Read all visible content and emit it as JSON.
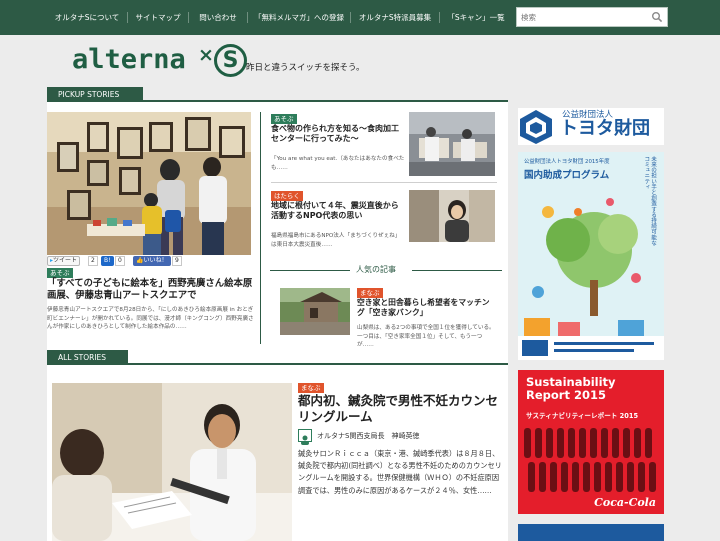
{
  "nav": {
    "items": [
      "オルタナSについて",
      "サイトマップ",
      "問い合わせ",
      "「無料メルマガ」への登録",
      "オルタナS特派員募集",
      "「Sキャン」一覧"
    ],
    "search_placeholder": "検索"
  },
  "logo": {
    "text": "alterna",
    "x": "×",
    "s": "S",
    "tagline": "昨日と違うスイッチを探そう。"
  },
  "sections": {
    "pickup": "PICKUP STORIES",
    "all": "ALL STORIES",
    "popular": "人気の記事"
  },
  "feature": {
    "social": {
      "tweet": "ツイート",
      "tweet_count": "2",
      "bookmark": "B!",
      "bookmark_count": "0",
      "like": "いいね！",
      "like_count": "9"
    },
    "category": "あそぶ",
    "title": "「すべての子どもに絵本を」西野亮廣さん絵本原画展、伊藤忠青山アートスクエアで",
    "excerpt": "伊藤忠青山アートスクエアで8月28日から、「にしのあきひろ絵本原画展 in おとぎ町ビエンナーレ」が開かれている。同展では、漫才師（キングコング）西野亮廣さんが作家にしのあきひろとして制作した絵本作品の……"
  },
  "pickups": [
    {
      "category": "あそぶ",
      "title": "食べ物の作られ方を知る～食肉加工センターに行ってみた～",
      "excerpt": "「You are what you eat.（あなたはあなたの食べたも……"
    },
    {
      "category": "はたらく",
      "title": "地域に根付いて４年、震災直後から活動するNPO代表の思い",
      "excerpt": "福島県福島市にあるNPO法人「まちづくりぜぇね」は東日本大震災直後……"
    }
  ],
  "popular": [
    {
      "category": "まなぶ",
      "title": "空き家と田舎暮らし希望者をマッチング「空き家バンク」",
      "excerpt": "山梨県は、ある2つの事項で全国１位を獲得している。一つ目は、「空き家率全国１位」そして、もう一つが……"
    }
  ],
  "all_story": {
    "category": "まなぶ",
    "title": "都内初、鍼灸院で男性不妊カウンセリングルーム",
    "author": "オルタナS関西支局長　神崎英徳",
    "excerpt": "鍼灸サロンＲｉｃｃａ（東京・港、鍼崎季代表）は８月８日、鍼灸院で都内初(同社調べ）となる男性不妊のためのカウンセリングルームを開設する。世界保健機構（ＷＨＯ）の不妊症原因調査では、男性のみに原因があるケースが２４％、女性……"
  },
  "sidebar": {
    "foundation": {
      "small": "公益財団法人",
      "name": "トヨタ財団"
    },
    "grant": {
      "header": "公益財団法人トヨタ財団 2015年度",
      "title": "国内助成プログラム",
      "side": "未来の担い手と創造する持続可能なコミュニティ"
    },
    "report": {
      "title": "Sustainability Report 2015",
      "subtitle": "サスティナビリティーレポート 2015",
      "brand": "Coca-Cola"
    }
  },
  "colors": {
    "brand": "#2d5a45",
    "category_orange": "#e0542c",
    "category_green": "#2e7d5b",
    "coke_red": "#e41e2b",
    "toyota_blue": "#1d5a9e"
  }
}
